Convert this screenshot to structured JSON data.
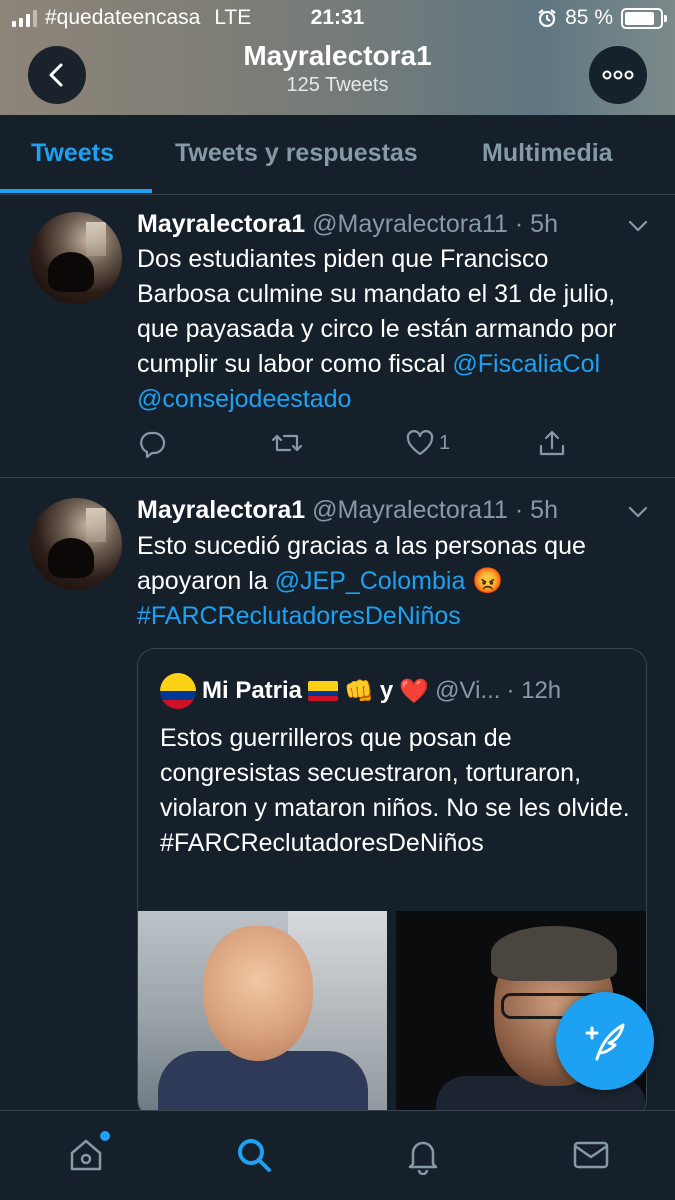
{
  "status_bar": {
    "carrier": "#quedateencasa",
    "network": "LTE",
    "time": "21:31",
    "battery_percent": "85 %"
  },
  "header": {
    "title": "Mayralectora1",
    "subtitle": "125 Tweets"
  },
  "tabs": [
    {
      "label": "Tweets",
      "active": true
    },
    {
      "label": "Tweets y respuestas",
      "active": false
    },
    {
      "label": "Multimedia",
      "active": false
    }
  ],
  "tweets": [
    {
      "name": "Mayralectora1",
      "handle": "@Mayralectora11",
      "time": "· 5h",
      "text": "Dos estudiantes piden que Francisco Barbosa culmine su mandato el 31 de julio, que payasada y circo le están armando por cumplir su labor como fiscal ",
      "mention1": "@FiscaliaCol",
      "mention2": "@consejodeestado",
      "likes": "1"
    },
    {
      "name": "Mayralectora1",
      "handle": "@Mayralectora11",
      "time": "· 5h",
      "text_before": "Esto sucedió gracias a las personas que apoyaron la ",
      "mention": "@JEP_Colombia",
      "emoji": "😡",
      "hashtag": "#FARCReclutadoresDeNiños",
      "quote": {
        "name": "Mi Patria",
        "emoji_fist": "👊",
        "connector": "y",
        "emoji_heart": "❤️",
        "handle": "@Vi...",
        "time": "· 12h",
        "text": "Estos guerrilleros que posan de congresistas secuestraron, torturaron, violaron y mataron niños. No se les olvide.",
        "hashtag": "#FARCReclutadoresDeNiños"
      }
    }
  ],
  "colors": {
    "background": "#15202b",
    "accent": "#1da1f2",
    "secondary_text": "#8899a6",
    "divider": "#38444d"
  },
  "icons": [
    "back-arrow-icon",
    "more-icon",
    "chevron-down-icon",
    "reply-icon",
    "retweet-icon",
    "like-icon",
    "share-icon",
    "compose-icon",
    "home-icon",
    "search-icon",
    "notifications-icon",
    "messages-icon"
  ]
}
